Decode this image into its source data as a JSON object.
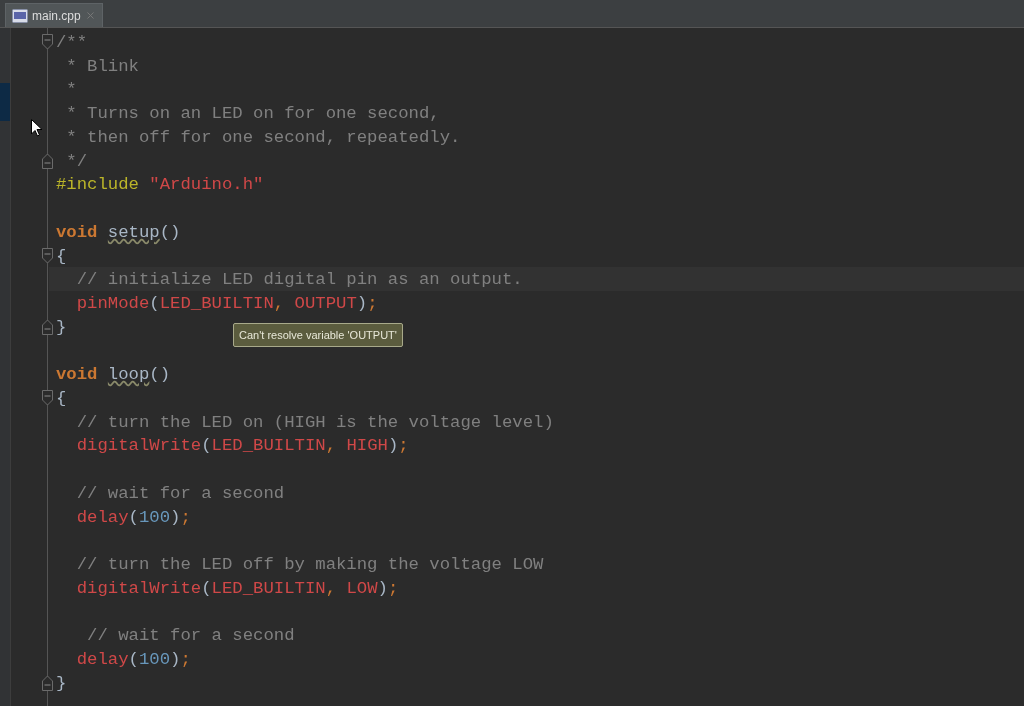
{
  "tab": {
    "label": "main.cpp",
    "selected": true
  },
  "lines": [
    {
      "kind": "open",
      "tokens": [
        {
          "kind": "comment",
          "text": "/**"
        }
      ]
    },
    {
      "kind": "code",
      "tokens": [
        {
          "kind": "comment",
          "text": " * Blink"
        }
      ]
    },
    {
      "kind": "code",
      "tokens": [
        {
          "kind": "comment",
          "text": " *"
        }
      ]
    },
    {
      "kind": "code",
      "tokens": [
        {
          "kind": "comment",
          "text": " * Turns on an LED on for one second,"
        }
      ]
    },
    {
      "kind": "code",
      "tokens": [
        {
          "kind": "comment",
          "text": " * then off for one second, repeatedly."
        }
      ]
    },
    {
      "kind": "close",
      "tokens": [
        {
          "kind": "comment",
          "text": " */"
        }
      ]
    },
    {
      "kind": "code",
      "tokens": [
        {
          "kind": "preproc",
          "text": "#include "
        },
        {
          "kind": "string",
          "text": "\"Arduino.h\""
        }
      ]
    },
    {
      "kind": "blank"
    },
    {
      "kind": "code",
      "tokens": [
        {
          "kind": "keyword",
          "text": "void "
        },
        {
          "kind": "unused",
          "text": "setup"
        },
        {
          "kind": "punct",
          "text": "()"
        }
      ]
    },
    {
      "kind": "open",
      "tokens": [
        {
          "kind": "punct",
          "text": "{"
        }
      ]
    },
    {
      "kind": "code",
      "current": true,
      "tokens": [
        {
          "kind": "comment",
          "text": "  // initialize LED digital pin as an output."
        }
      ]
    },
    {
      "kind": "code",
      "tokens": [
        {
          "kind": "func",
          "text": "  pinMode"
        },
        {
          "kind": "punct",
          "text": "("
        },
        {
          "kind": "const",
          "text": "LED_BUILTIN"
        },
        {
          "kind": "semi",
          "text": ", "
        },
        {
          "kind": "const",
          "text": "OUTPUT"
        },
        {
          "kind": "punct",
          "text": ")"
        },
        {
          "kind": "semi",
          "text": ";"
        }
      ]
    },
    {
      "kind": "close",
      "tokens": [
        {
          "kind": "punct",
          "text": "}"
        }
      ]
    },
    {
      "kind": "blank"
    },
    {
      "kind": "code",
      "tokens": [
        {
          "kind": "keyword",
          "text": "void "
        },
        {
          "kind": "unused",
          "text": "loop"
        },
        {
          "kind": "punct",
          "text": "()"
        }
      ]
    },
    {
      "kind": "open",
      "tokens": [
        {
          "kind": "punct",
          "text": "{"
        }
      ]
    },
    {
      "kind": "code",
      "tokens": [
        {
          "kind": "comment",
          "text": "  // turn the LED on (HIGH is the voltage level)"
        }
      ]
    },
    {
      "kind": "code",
      "tokens": [
        {
          "kind": "func",
          "text": "  digitalWrite"
        },
        {
          "kind": "punct",
          "text": "("
        },
        {
          "kind": "const",
          "text": "LED_BUILTIN"
        },
        {
          "kind": "semi",
          "text": ", "
        },
        {
          "kind": "const",
          "text": "HIGH"
        },
        {
          "kind": "punct",
          "text": ")"
        },
        {
          "kind": "semi",
          "text": ";"
        }
      ]
    },
    {
      "kind": "blank"
    },
    {
      "kind": "code",
      "tokens": [
        {
          "kind": "comment",
          "text": "  // wait for a second"
        }
      ]
    },
    {
      "kind": "code",
      "tokens": [
        {
          "kind": "func",
          "text": "  delay"
        },
        {
          "kind": "punct",
          "text": "("
        },
        {
          "kind": "number",
          "text": "100"
        },
        {
          "kind": "punct",
          "text": ")"
        },
        {
          "kind": "semi",
          "text": ";"
        }
      ]
    },
    {
      "kind": "blank"
    },
    {
      "kind": "code",
      "tokens": [
        {
          "kind": "comment",
          "text": "  // turn the LED off by making the voltage LOW"
        }
      ]
    },
    {
      "kind": "code",
      "tokens": [
        {
          "kind": "func",
          "text": "  digitalWrite"
        },
        {
          "kind": "punct",
          "text": "("
        },
        {
          "kind": "const",
          "text": "LED_BUILTIN"
        },
        {
          "kind": "semi",
          "text": ", "
        },
        {
          "kind": "const",
          "text": "LOW"
        },
        {
          "kind": "punct",
          "text": ")"
        },
        {
          "kind": "semi",
          "text": ";"
        }
      ]
    },
    {
      "kind": "blank"
    },
    {
      "kind": "code",
      "tokens": [
        {
          "kind": "comment",
          "text": "   // wait for a second"
        }
      ]
    },
    {
      "kind": "code",
      "tokens": [
        {
          "kind": "func",
          "text": "  delay"
        },
        {
          "kind": "punct",
          "text": "("
        },
        {
          "kind": "number",
          "text": "100"
        },
        {
          "kind": "punct",
          "text": ")"
        },
        {
          "kind": "semi",
          "text": ";"
        }
      ]
    },
    {
      "kind": "close",
      "tokens": [
        {
          "kind": "punct",
          "text": "}"
        }
      ]
    }
  ],
  "tooltip": {
    "text": "Can't resolve variable 'OUTPUT'"
  }
}
